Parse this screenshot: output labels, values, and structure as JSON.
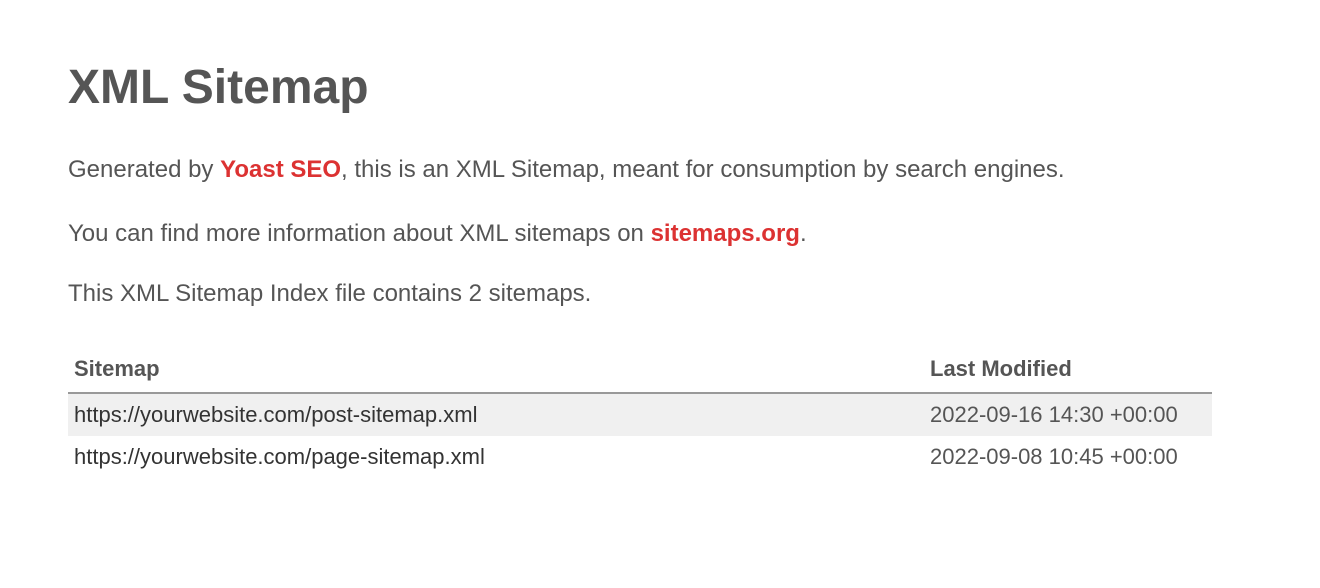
{
  "title": "XML Sitemap",
  "intro": {
    "line1_prefix": "Generated by ",
    "line1_link": "Yoast SEO",
    "line1_suffix": ", this is an XML Sitemap, meant for consumption by search engines.",
    "line2_prefix": "You can find more information about XML sitemaps on ",
    "line2_link": "sitemaps.org",
    "line2_suffix": "."
  },
  "count_line": "This XML Sitemap Index file contains 2 sitemaps.",
  "table": {
    "headers": {
      "sitemap": "Sitemap",
      "modified": "Last Modified"
    },
    "rows": [
      {
        "url": "https://yourwebsite.com/post-sitemap.xml",
        "modified": "2022-09-16 14:30 +00:00"
      },
      {
        "url": "https://yourwebsite.com/page-sitemap.xml",
        "modified": "2022-09-08 10:45 +00:00"
      }
    ]
  }
}
